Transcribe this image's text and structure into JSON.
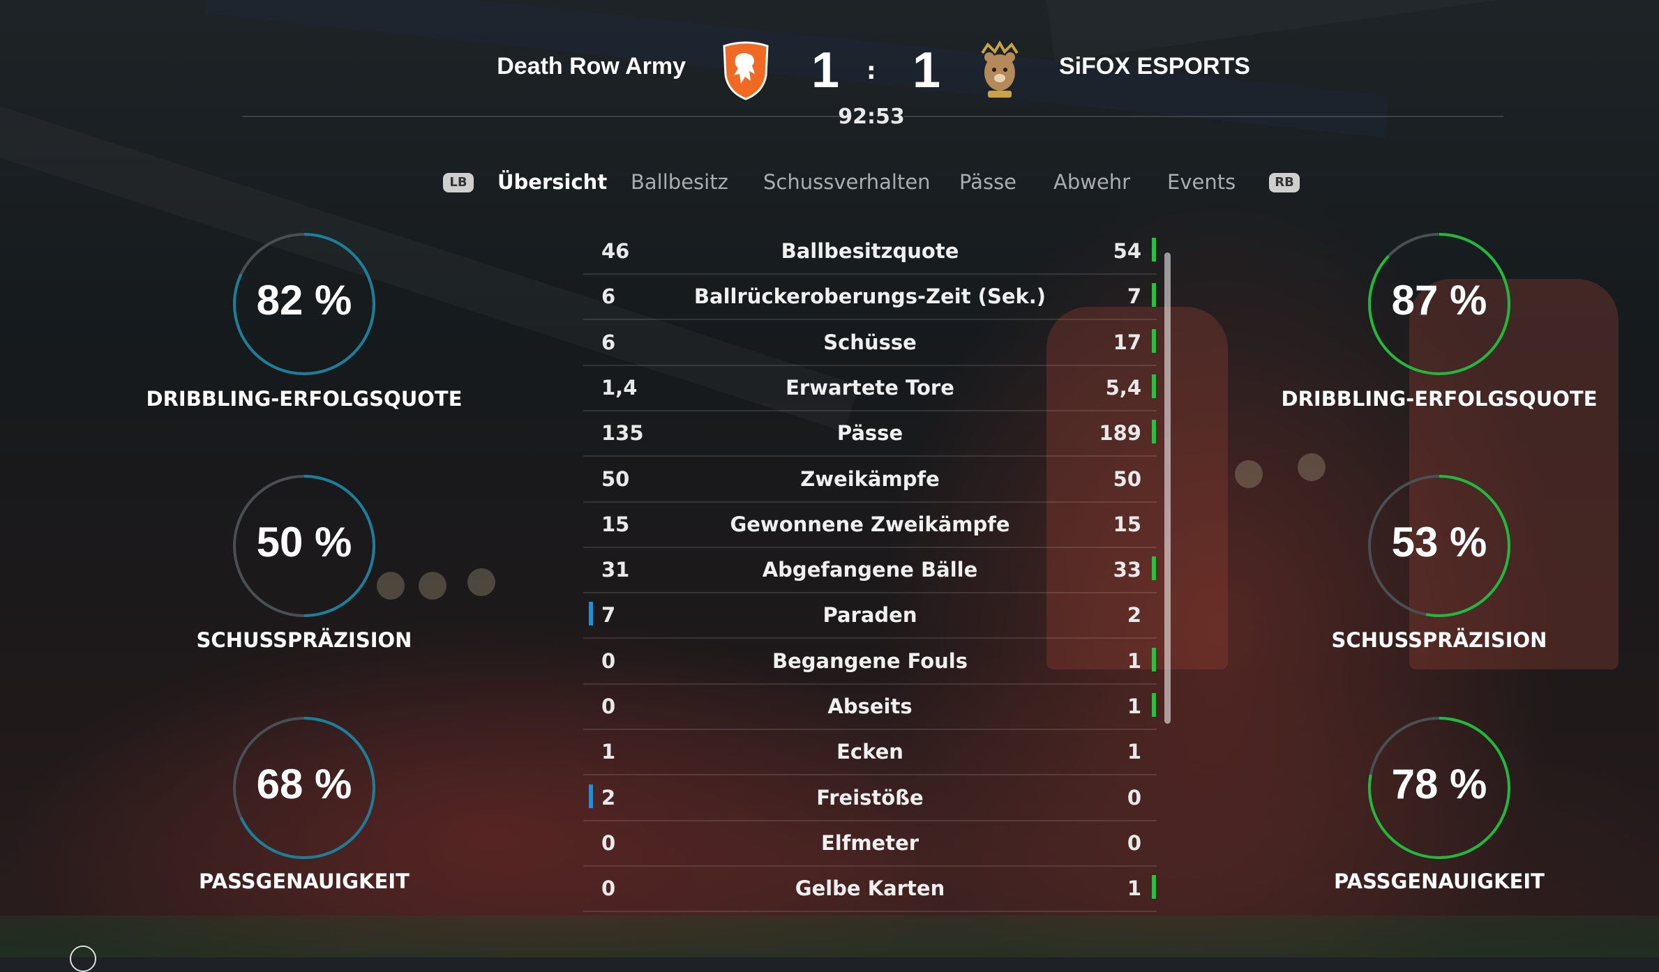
{
  "match": {
    "home_team": "Death Row Army",
    "away_team": "SiFOX ESPORTS",
    "home_score": "1",
    "away_score": "1",
    "separator": ":",
    "clock": "92:53"
  },
  "tabs": {
    "left_button": "LB",
    "right_button": "RB",
    "items": [
      "Übersicht",
      "Ballbesitz",
      "Schussverhalten",
      "Pässe",
      "Abwehr",
      "Events"
    ],
    "active": "Übersicht"
  },
  "stats": [
    {
      "label": "Ballbesitzquote",
      "home": "46",
      "away": "54",
      "leader": "away"
    },
    {
      "label": "Ballrückeroberungs-Zeit (Sek.)",
      "home": "6",
      "away": "7",
      "leader": "away"
    },
    {
      "label": "Schüsse",
      "home": "6",
      "away": "17",
      "leader": "away"
    },
    {
      "label": "Erwartete Tore",
      "home": "1,4",
      "away": "5,4",
      "leader": "away"
    },
    {
      "label": "Pässe",
      "home": "135",
      "away": "189",
      "leader": "away"
    },
    {
      "label": "Zweikämpfe",
      "home": "50",
      "away": "50",
      "leader": "none"
    },
    {
      "label": "Gewonnene Zweikämpfe",
      "home": "15",
      "away": "15",
      "leader": "none"
    },
    {
      "label": "Abgefangene Bälle",
      "home": "31",
      "away": "33",
      "leader": "away"
    },
    {
      "label": "Paraden",
      "home": "7",
      "away": "2",
      "leader": "home"
    },
    {
      "label": "Begangene Fouls",
      "home": "0",
      "away": "1",
      "leader": "away"
    },
    {
      "label": "Abseits",
      "home": "0",
      "away": "1",
      "leader": "away"
    },
    {
      "label": "Ecken",
      "home": "1",
      "away": "1",
      "leader": "none"
    },
    {
      "label": "Freistöße",
      "home": "2",
      "away": "0",
      "leader": "home"
    },
    {
      "label": "Elfmeter",
      "home": "0",
      "away": "0",
      "leader": "none"
    },
    {
      "label": "Gelbe Karten",
      "home": "0",
      "away": "1",
      "leader": "away"
    }
  ],
  "gauges": {
    "home": [
      {
        "value": "82 %",
        "fraction": 0.82,
        "label": "DRIBBLING-ERFOLGSQUOTE"
      },
      {
        "value": "50 %",
        "fraction": 0.5,
        "label": "SCHUSSPRÄZISION"
      },
      {
        "value": "68 %",
        "fraction": 0.68,
        "label": "PASSGENAUIGKEIT"
      }
    ],
    "away": [
      {
        "value": "87 %",
        "fraction": 0.87,
        "label": "DRIBBLING-ERFOLGSQUOTE"
      },
      {
        "value": "53 %",
        "fraction": 0.53,
        "label": "SCHUSSPRÄZISION"
      },
      {
        "value": "78 %",
        "fraction": 0.78,
        "label": "PASSGENAUIGKEIT"
      }
    ]
  },
  "colors": {
    "home_accent": "#1f8fd6",
    "away_accent": "#1bc83a",
    "home_gauge": "#1c7f99",
    "away_gauge": "#22b83c",
    "gauge_track": "#4a4f54"
  },
  "icons": {
    "home_crest": "orange-lion-crest-icon",
    "away_crest": "bear-crown-crest-icon"
  }
}
